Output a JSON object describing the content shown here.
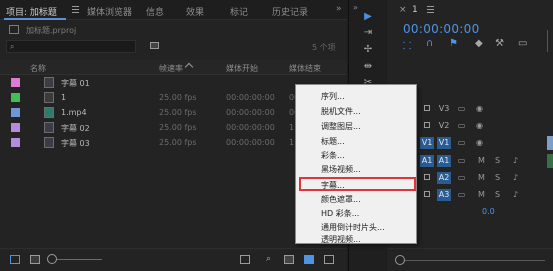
{
  "project_panel": {
    "tabs": [
      {
        "label": "项目: 加标题",
        "active": true
      },
      {
        "label": "媒体浏览器"
      },
      {
        "label": "信息"
      },
      {
        "label": "效果"
      },
      {
        "label": "标记"
      },
      {
        "label": "历史记录"
      }
    ],
    "tabs_more": "»",
    "project_file": "加标题.prproj",
    "search_placeholder": "",
    "item_count": "5 个项",
    "columns": {
      "name": "名称",
      "fps": "帧速率",
      "start": "媒体开始",
      "end": "媒体结束"
    },
    "rows": [
      {
        "name": "字幕 01",
        "fps": "",
        "start": "",
        "end": "",
        "color": "#e07ad8",
        "icon": "caption-icon"
      },
      {
        "name": "1",
        "fps": "25.00 fps",
        "start": "00:00:00:00",
        "end": "00:",
        "color": "#3fc057",
        "icon": "sequence-icon"
      },
      {
        "name": "1.mp4",
        "fps": "25.00 fps",
        "start": "00:00:00:00",
        "end": "00:",
        "color": "#6d97d8",
        "icon": "video-file-icon"
      },
      {
        "name": "字幕 02",
        "fps": "25.00 fps",
        "start": "00:00:00:00",
        "end": "11:",
        "color": "#b58be0",
        "icon": "caption-icon"
      },
      {
        "name": "字幕 03",
        "fps": "25.00 fps",
        "start": "00:00:00:00",
        "end": "11:",
        "color": "#b58be0",
        "icon": "caption-icon"
      }
    ]
  },
  "context_menu": {
    "items": [
      "序列...",
      "脱机文件...",
      "调整图层...",
      "标题...",
      "彩条...",
      "黑场视频...",
      "字幕...",
      "颜色遮罩...",
      "HD 彩条...",
      "通用倒计时片头...",
      "透明视频..."
    ],
    "highlighted_item": "字幕..."
  },
  "timeline": {
    "close": "×",
    "sequence_name": "1",
    "timecode": "00:00:00:00",
    "video_tracks": [
      "V3",
      "V2",
      "V1"
    ],
    "audio_tracks": [
      "A1",
      "A2",
      "A3"
    ],
    "source_patches": [
      "V1",
      "A1"
    ],
    "audio_buttons": {
      "mute": "M",
      "solo": "S"
    },
    "master_volume": "0.0"
  },
  "colors": {
    "accent": "#4f93e3",
    "highlight_box": "#e0343a",
    "track_active": "#2a5c92"
  }
}
